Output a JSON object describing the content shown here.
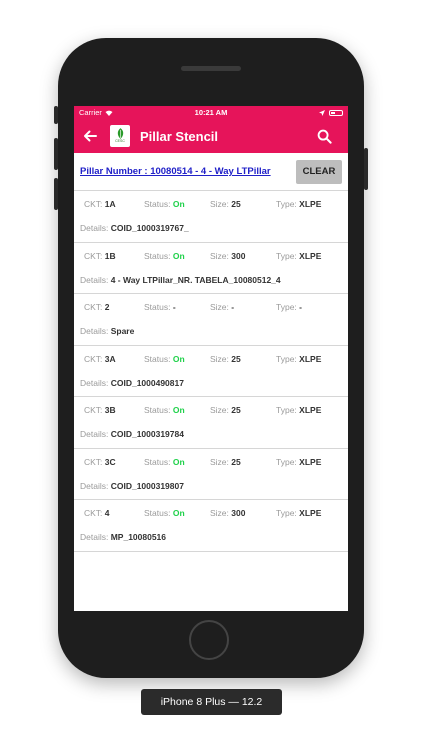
{
  "statusbar": {
    "carrier": "Carrier",
    "time": "10:21 AM"
  },
  "appbar": {
    "title": "Pillar Stencil",
    "logo_text": "CESC"
  },
  "pillar": {
    "number_label": "Pillar Number : 10080514 - 4 - Way LTPillar",
    "clear_label": "CLEAR"
  },
  "labels": {
    "ckt": "CKT:",
    "status": "Status:",
    "size": "Size:",
    "type": "Type:",
    "details": "Details:"
  },
  "rows": [
    {
      "ckt": "1A",
      "status": "On",
      "size": "25",
      "type": "XLPE",
      "details": "COID_1000319767_"
    },
    {
      "ckt": "1B",
      "status": "On",
      "size": "300",
      "type": "XLPE",
      "details": "4 - Way  LTPillar_NR. TABELA_10080512_4"
    },
    {
      "ckt": "2",
      "status": "-",
      "size": "-",
      "type": "-",
      "details": "Spare"
    },
    {
      "ckt": "3A",
      "status": "On",
      "size": "25",
      "type": "XLPE",
      "details": "COID_1000490817"
    },
    {
      "ckt": "3B",
      "status": "On",
      "size": "25",
      "type": "XLPE",
      "details": "COID_1000319784"
    },
    {
      "ckt": "3C",
      "status": "On",
      "size": "25",
      "type": "XLPE",
      "details": "COID_1000319807"
    },
    {
      "ckt": "4",
      "status": "On",
      "size": "300",
      "type": "XLPE",
      "details": "MP_10080516"
    }
  ],
  "device_label": "iPhone 8 Plus — 12.2",
  "colors": {
    "brand": "#e6145a",
    "status_on": "#1fd14a",
    "link": "#2020c8"
  }
}
